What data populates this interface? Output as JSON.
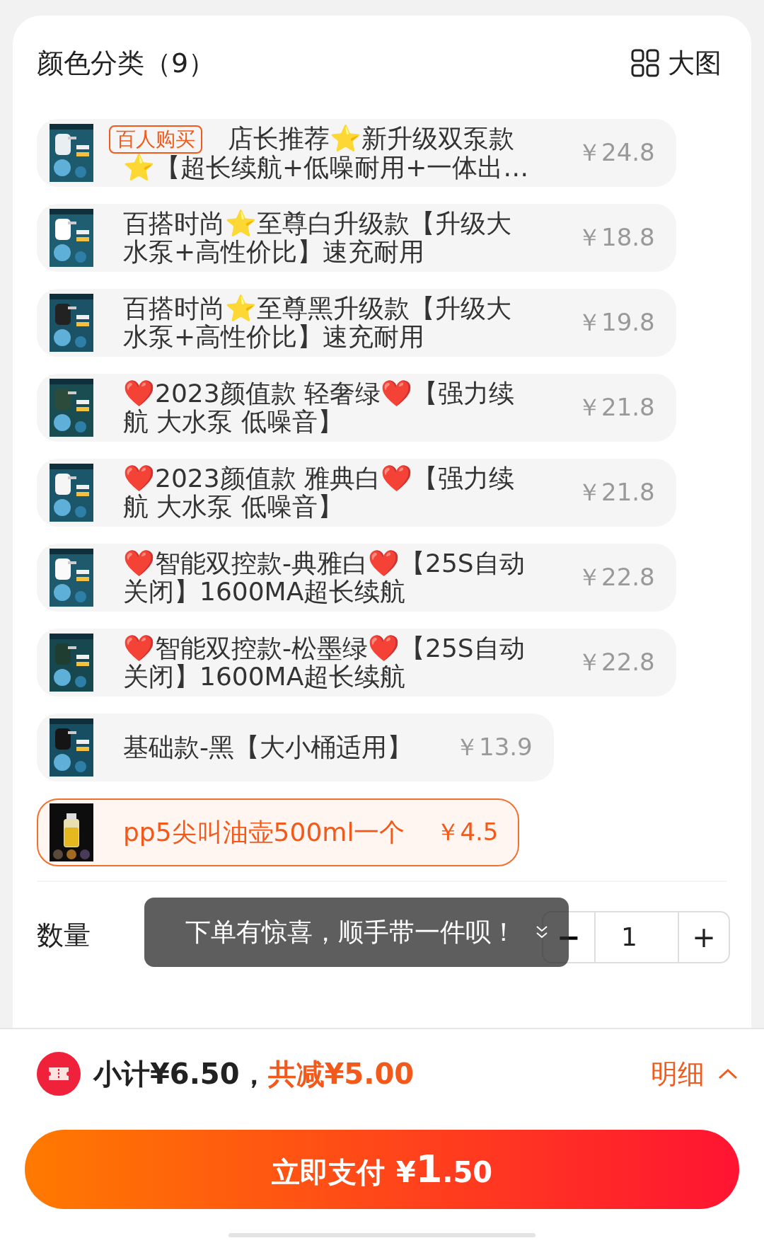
{
  "header": {
    "title": "颜色分类（9）",
    "view_toggle": "大图"
  },
  "options": [
    {
      "badge": "百人购买",
      "title": "店长推荐⭐新升级双泵款⭐【超长续航+低噪耐用+一体出…",
      "price": "￥24.8",
      "selected": false
    },
    {
      "title": "百搭时尚⭐至尊白升级款【升级大水泵+高性价比】速充耐用",
      "price": "￥18.8",
      "selected": false
    },
    {
      "title": "百搭时尚⭐至尊黑升级款【升级大水泵+高性价比】速充耐用",
      "price": "￥19.8",
      "selected": false
    },
    {
      "title": "❤️2023颜值款 轻奢绿❤️【强力续航 大水泵 低噪音】",
      "price": "￥21.8",
      "selected": false
    },
    {
      "title": "❤️2023颜值款 雅典白❤️【强力续航 大水泵 低噪音】",
      "price": "￥21.8",
      "selected": false
    },
    {
      "title": "❤️智能双控款-典雅白❤️【25S自动关闭】1600MA超长续航",
      "price": "￥22.8",
      "selected": false
    },
    {
      "title": "❤️智能双控款-松墨绿❤️【25S自动关闭】1600MA超长续航",
      "price": "￥22.8",
      "selected": false
    },
    {
      "title": "基础款-黑【大小桶适用】",
      "price": "￥13.9",
      "selected": false
    },
    {
      "title": "pp5尖叫油壶500ml一个",
      "price": "￥4.5",
      "selected": true
    }
  ],
  "quantity": {
    "label": "数量",
    "minus": "−",
    "value": "1",
    "plus": "+"
  },
  "toast": {
    "text": "下单有惊喜，顺手带一件呗！"
  },
  "summary": {
    "subtotal": "小计¥6.50，",
    "discount": "共减¥5.00",
    "details": "明细"
  },
  "pay_button": {
    "label": "立即支付",
    "currency": "¥",
    "amount_int": "1",
    "amount_dec": ".50"
  }
}
